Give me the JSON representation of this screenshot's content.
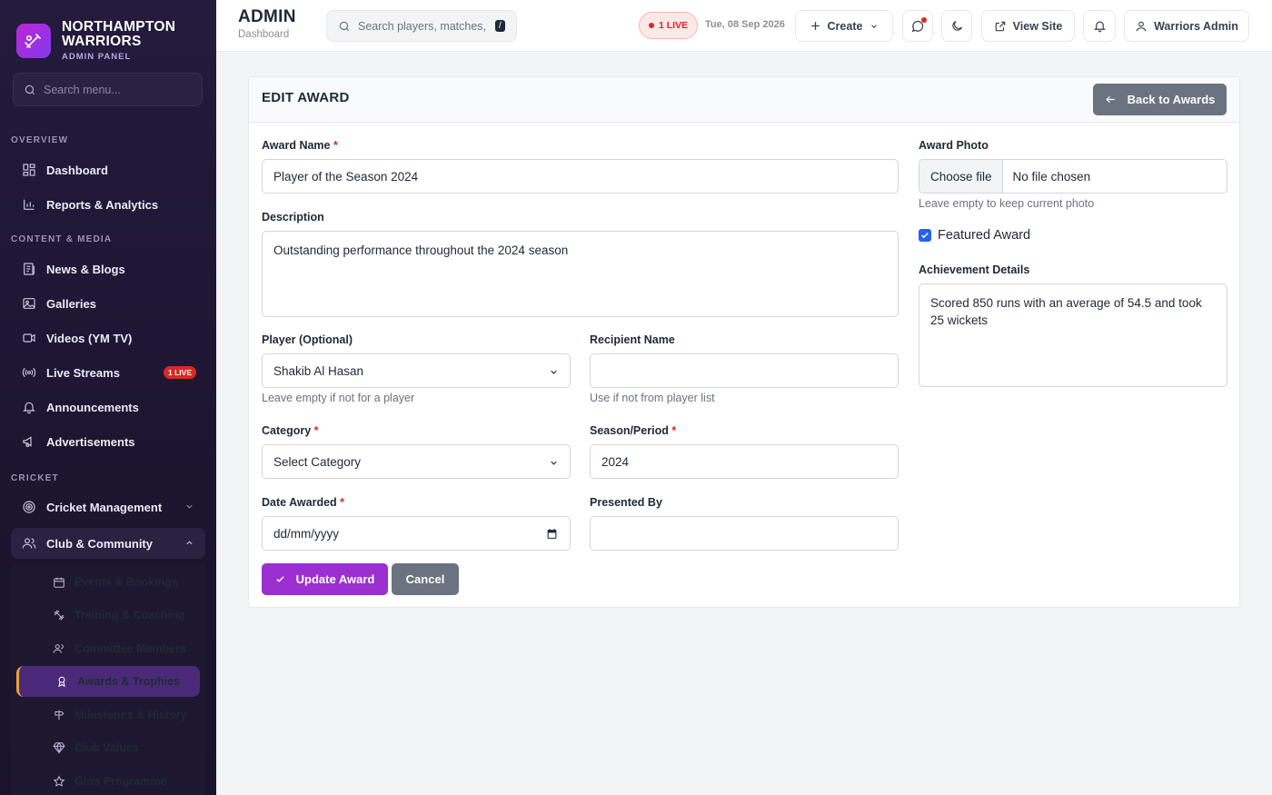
{
  "brand": {
    "title_line1": "NORTHAMPTON",
    "title_line2": "WARRIORS",
    "subtitle": "ADMIN PANEL"
  },
  "sidebar": {
    "search_placeholder": "Search menu...",
    "sections": {
      "overview": "OVERVIEW",
      "content": "CONTENT & MEDIA",
      "cricket": "CRICKET"
    },
    "items": {
      "dashboard": "Dashboard",
      "reports": "Reports & Analytics",
      "news": "News & Blogs",
      "galleries": "Galleries",
      "videos": "Videos (YM TV)",
      "live_streams": "Live Streams",
      "live_badge": "1 LIVE",
      "announcements": "Announcements",
      "advertisements": "Advertisements",
      "cricket_mgmt": "Cricket Management",
      "club_community": "Club & Community"
    },
    "sub_items": {
      "events": "Events & Bookings",
      "training": "Training & Coaching",
      "committee": "Committee Members",
      "awards": "Awards & Trophies",
      "milestones": "Milestones & History",
      "values": "Club Values",
      "girls": "Girls Programme"
    }
  },
  "topbar": {
    "title": "ADMIN",
    "subtitle": "Dashboard",
    "search_placeholder": "Search players, matches, r",
    "search_kbd": "/",
    "live_pill": "1 LIVE",
    "date": "Tue, 08 Sep 2026",
    "create_label": "Create",
    "view_site_label": "View Site",
    "user_label": "Warriors Admin"
  },
  "form": {
    "title": "EDIT AWARD",
    "back_label": "Back to Awards",
    "award_name_label": "Award Name",
    "award_name_value": "Player of the Season 2024",
    "description_label": "Description",
    "description_value": "Outstanding performance throughout the 2024 season",
    "player_label": "Player (Optional)",
    "player_value": "Shakib Al Hasan",
    "player_help": "Leave empty if not for a player",
    "recipient_label": "Recipient Name",
    "recipient_value": "",
    "recipient_help": "Use if not from player list",
    "category_label": "Category",
    "category_value": "Select Category",
    "season_label": "Season/Period",
    "season_value": "2024",
    "date_label": "Date Awarded",
    "date_placeholder": "dd/mm/yyyy",
    "presented_label": "Presented By",
    "presented_value": "",
    "photo_label": "Award Photo",
    "choose_file": "Choose file",
    "no_file": "No file chosen",
    "photo_help": "Leave empty to keep current photo",
    "featured_label": "Featured Award",
    "featured_checked": true,
    "achievement_label": "Achievement Details",
    "achievement_value": "Scored 850 runs with an average of 54.5 and took 25 wickets",
    "update_label": "Update Award",
    "cancel_label": "Cancel",
    "required_mark": "*"
  },
  "colors": {
    "accent": "#9b2fcf",
    "sidebar_bg": "#241a3d",
    "live": "#dc2626"
  }
}
